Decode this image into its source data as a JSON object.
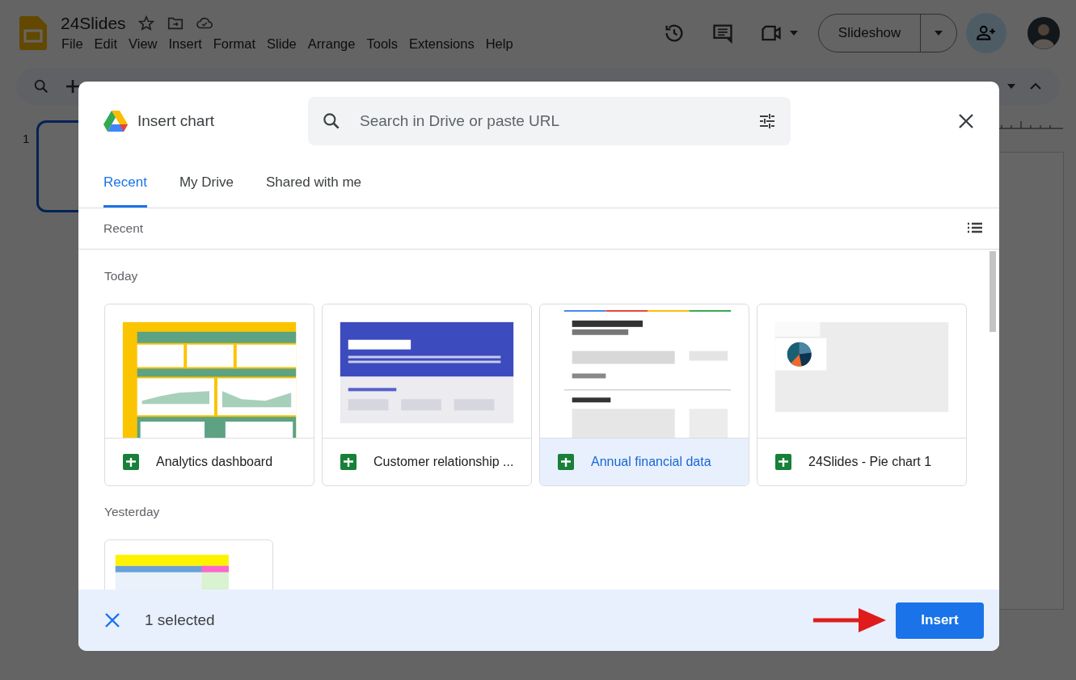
{
  "app": {
    "title": "24Slides",
    "menu": [
      "File",
      "Edit",
      "View",
      "Insert",
      "Format",
      "Slide",
      "Arrange",
      "Tools",
      "Extensions",
      "Help"
    ],
    "present_button": "Slideshow",
    "slide_number": "1"
  },
  "dialog": {
    "title": "Insert chart",
    "search": {
      "placeholder": "Search in Drive or paste URL"
    },
    "tabs": [
      {
        "label": "Recent",
        "selected": true
      },
      {
        "label": "My Drive",
        "selected": false
      },
      {
        "label": "Shared with me",
        "selected": false
      }
    ],
    "section_header": "Recent",
    "groups": [
      {
        "label": "Today",
        "files": [
          {
            "name": "Analytics dashboard",
            "selected": false
          },
          {
            "name": "Customer relationship ...",
            "selected": false
          },
          {
            "name": "Annual financial data",
            "selected": true
          },
          {
            "name": "24Slides - Pie chart 1",
            "selected": false
          }
        ]
      },
      {
        "label": "Yesterday"
      }
    ],
    "selection_count": "1 selected",
    "insert_button": "Insert"
  }
}
